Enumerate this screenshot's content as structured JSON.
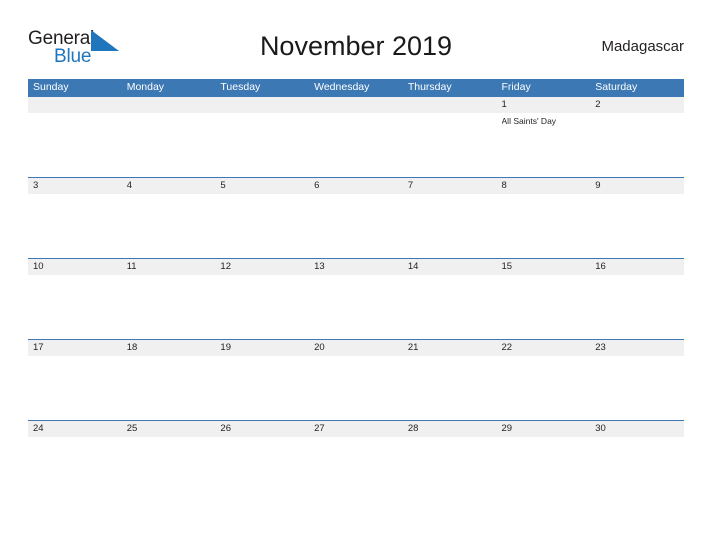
{
  "brand": {
    "name_part1": "General",
    "name_part2": "Blue",
    "flag_icon": "blue-triangle-flag-icon",
    "color_primary": "#1f76bc",
    "color_text": "#231f20"
  },
  "header": {
    "title": "November 2019",
    "country": "Madagascar"
  },
  "calendar": {
    "accent_color": "#3c78b4",
    "band_color": "#f0f0f0",
    "weekdays": [
      "Sunday",
      "Monday",
      "Tuesday",
      "Wednesday",
      "Thursday",
      "Friday",
      "Saturday"
    ],
    "weeks": [
      {
        "days": [
          {
            "number": "",
            "event": ""
          },
          {
            "number": "",
            "event": ""
          },
          {
            "number": "",
            "event": ""
          },
          {
            "number": "",
            "event": ""
          },
          {
            "number": "",
            "event": ""
          },
          {
            "number": "1",
            "event": "All Saints' Day"
          },
          {
            "number": "2",
            "event": ""
          }
        ]
      },
      {
        "days": [
          {
            "number": "3",
            "event": ""
          },
          {
            "number": "4",
            "event": ""
          },
          {
            "number": "5",
            "event": ""
          },
          {
            "number": "6",
            "event": ""
          },
          {
            "number": "7",
            "event": ""
          },
          {
            "number": "8",
            "event": ""
          },
          {
            "number": "9",
            "event": ""
          }
        ]
      },
      {
        "days": [
          {
            "number": "10",
            "event": ""
          },
          {
            "number": "11",
            "event": ""
          },
          {
            "number": "12",
            "event": ""
          },
          {
            "number": "13",
            "event": ""
          },
          {
            "number": "14",
            "event": ""
          },
          {
            "number": "15",
            "event": ""
          },
          {
            "number": "16",
            "event": ""
          }
        ]
      },
      {
        "days": [
          {
            "number": "17",
            "event": ""
          },
          {
            "number": "18",
            "event": ""
          },
          {
            "number": "19",
            "event": ""
          },
          {
            "number": "20",
            "event": ""
          },
          {
            "number": "21",
            "event": ""
          },
          {
            "number": "22",
            "event": ""
          },
          {
            "number": "23",
            "event": ""
          }
        ]
      },
      {
        "days": [
          {
            "number": "24",
            "event": ""
          },
          {
            "number": "25",
            "event": ""
          },
          {
            "number": "26",
            "event": ""
          },
          {
            "number": "27",
            "event": ""
          },
          {
            "number": "28",
            "event": ""
          },
          {
            "number": "29",
            "event": ""
          },
          {
            "number": "30",
            "event": ""
          }
        ]
      }
    ]
  }
}
